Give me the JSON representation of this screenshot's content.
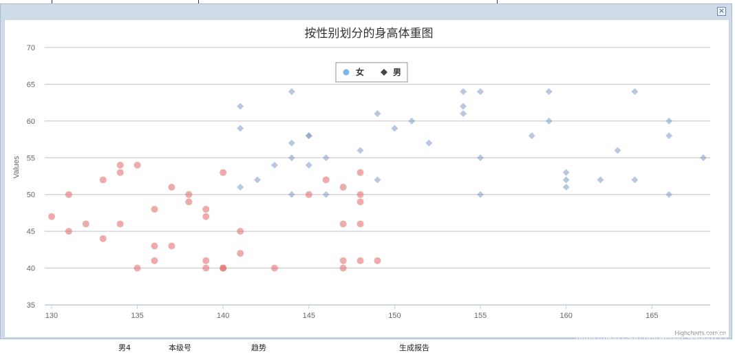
{
  "background": {
    "bottom_texts": [
      "男4",
      "本级号",
      "趋势",
      "生成报告"
    ]
  },
  "dialog": {
    "close_icon": "close-icon",
    "accent": "#cfdbe9"
  },
  "credits": "Highcharts.com.cn",
  "watermark": "https://blog.csdn.net/weixin_44303771",
  "chart_data": {
    "type": "scatter",
    "title": "按性别划分的身高体重图",
    "xlabel": "",
    "ylabel": "Values",
    "xlim": [
      129.6,
      168.4
    ],
    "ylim": [
      35,
      70
    ],
    "xticks": [
      130,
      135,
      140,
      145,
      150,
      155,
      160,
      165
    ],
    "yticks": [
      35,
      40,
      45,
      50,
      55,
      60,
      65,
      70
    ],
    "grid": true,
    "legend_position": "top-center",
    "series": [
      {
        "name": "女",
        "marker": "circle",
        "color": "#e06666",
        "legend_color": "#7cb5ec",
        "points": [
          [
            130,
            47
          ],
          [
            131,
            50
          ],
          [
            131,
            45
          ],
          [
            132,
            46
          ],
          [
            133,
            52
          ],
          [
            133,
            44
          ],
          [
            134,
            54
          ],
          [
            134,
            53
          ],
          [
            134,
            46
          ],
          [
            135,
            54
          ],
          [
            135,
            40
          ],
          [
            136,
            48
          ],
          [
            136,
            43
          ],
          [
            136,
            41
          ],
          [
            137,
            51
          ],
          [
            137,
            43
          ],
          [
            138,
            50
          ],
          [
            138,
            49
          ],
          [
            139,
            48
          ],
          [
            139,
            47
          ],
          [
            139,
            41
          ],
          [
            139,
            40
          ],
          [
            140,
            53
          ],
          [
            140,
            40
          ],
          [
            140,
            40
          ],
          [
            141,
            45
          ],
          [
            141,
            42
          ],
          [
            143,
            40
          ],
          [
            145,
            50
          ],
          [
            146,
            52
          ],
          [
            147,
            51
          ],
          [
            147,
            46
          ],
          [
            147,
            41
          ],
          [
            147,
            40
          ],
          [
            148,
            53
          ],
          [
            148,
            50
          ],
          [
            148,
            49
          ],
          [
            148,
            46
          ],
          [
            148,
            41
          ],
          [
            149,
            41
          ]
        ]
      },
      {
        "name": "男",
        "marker": "diamond",
        "color": "#7f9bc6",
        "legend_color": "#434348",
        "points": [
          [
            141,
            62
          ],
          [
            141,
            59
          ],
          [
            141,
            51
          ],
          [
            142,
            52
          ],
          [
            143,
            54
          ],
          [
            144,
            64
          ],
          [
            144,
            57
          ],
          [
            144,
            55
          ],
          [
            144,
            50
          ],
          [
            145,
            58
          ],
          [
            145,
            58
          ],
          [
            145,
            54
          ],
          [
            146,
            55
          ],
          [
            146,
            50
          ],
          [
            148,
            56
          ],
          [
            149,
            61
          ],
          [
            149,
            52
          ],
          [
            150,
            59
          ],
          [
            151,
            60
          ],
          [
            152,
            57
          ],
          [
            154,
            64
          ],
          [
            154,
            62
          ],
          [
            154,
            61
          ],
          [
            155,
            64
          ],
          [
            155,
            55
          ],
          [
            155,
            50
          ],
          [
            158,
            58
          ],
          [
            159,
            64
          ],
          [
            159,
            60
          ],
          [
            160,
            53
          ],
          [
            160,
            52
          ],
          [
            160,
            51
          ],
          [
            162,
            52
          ],
          [
            163,
            56
          ],
          [
            164,
            64
          ],
          [
            164,
            52
          ],
          [
            166,
            60
          ],
          [
            166,
            58
          ],
          [
            166,
            50
          ],
          [
            168,
            55
          ]
        ]
      }
    ]
  }
}
